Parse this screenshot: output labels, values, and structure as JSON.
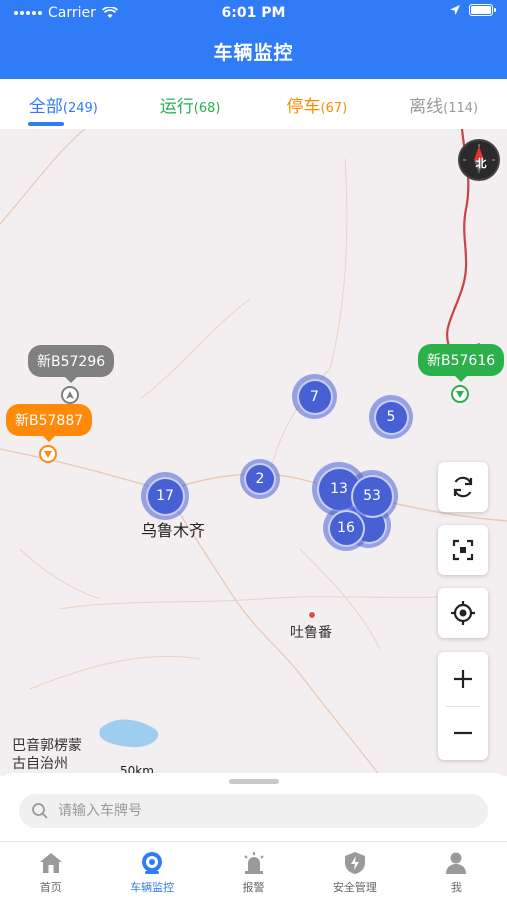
{
  "status_bar": {
    "carrier": "Carrier",
    "time": "6:01 PM"
  },
  "header": {
    "title": "车辆监控"
  },
  "tabs": [
    {
      "label": "全部",
      "count": "(249)"
    },
    {
      "label": "运行",
      "count": "(68)"
    },
    {
      "label": "停车",
      "count": "(67)"
    },
    {
      "label": "离线",
      "count": "(114)"
    }
  ],
  "map": {
    "compass_label": "北",
    "cities": {
      "urumqi": "乌鲁木齐",
      "turpan": "吐鲁番"
    },
    "region_label": {
      "line1": "巴音郭楞蒙",
      "line2": "古自治州"
    },
    "scale": "50km",
    "clusters": [
      "7",
      "5",
      "2",
      "17",
      "13",
      "53",
      "16"
    ],
    "vehicles": [
      {
        "plate": "新B57296",
        "status": "offline"
      },
      {
        "plate": "新B57887",
        "status": "parked"
      },
      {
        "plate": "新B57616",
        "status": "running"
      }
    ],
    "colors": {
      "offline": "#808080",
      "parked": "#ff8a0a",
      "running": "#2bb04a",
      "cluster": "#4760d4"
    }
  },
  "search": {
    "placeholder": "请输入车牌号"
  },
  "tabbar": [
    {
      "label": "首页",
      "icon": "home-icon"
    },
    {
      "label": "车辆监控",
      "icon": "vehicle-monitor-icon"
    },
    {
      "label": "报警",
      "icon": "alarm-icon"
    },
    {
      "label": "安全管理",
      "icon": "shield-icon"
    },
    {
      "label": "我",
      "icon": "user-icon"
    }
  ],
  "accent_color": "#2f7cf6"
}
